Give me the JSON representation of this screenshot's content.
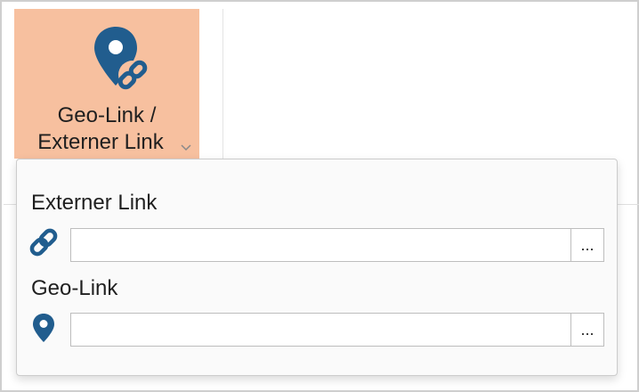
{
  "ribbon": {
    "button": {
      "label_line1": "Geo-Link /",
      "label_line2": "Externer Link",
      "icon": "map-pin-link-icon",
      "chevron_icon": "chevron-down-icon",
      "background_color": "#f7c09f"
    }
  },
  "dropdown": {
    "external_link": {
      "label": "Externer Link",
      "icon": "link-icon",
      "value": "",
      "browse_label": "..."
    },
    "geo_link": {
      "label": "Geo-Link",
      "icon": "map-pin-icon",
      "value": "",
      "browse_label": "..."
    }
  },
  "colors": {
    "icon_blue": "#215d8e",
    "panel_background": "#fafafa"
  }
}
